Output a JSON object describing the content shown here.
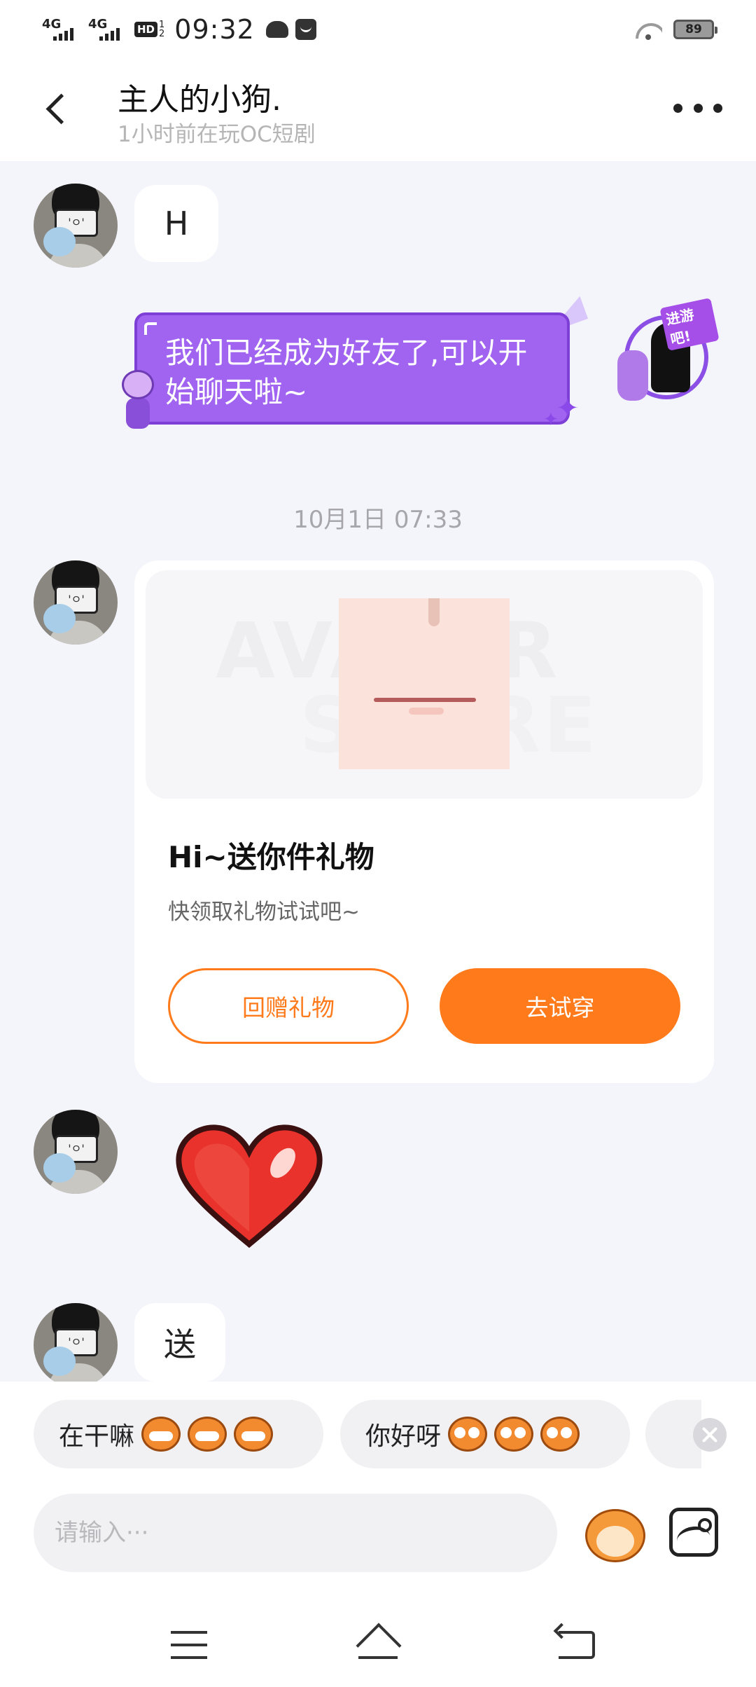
{
  "status_bar": {
    "network1": "4G",
    "network2": "4G",
    "hd_label": "HD",
    "hd_sub1": "1",
    "hd_sub2": "2",
    "time": "09:32",
    "battery": "89"
  },
  "header": {
    "title": "主人的小狗.",
    "subtitle": "1小时前在玩OC短剧"
  },
  "messages": {
    "first": "H",
    "system_bubble": "我们已经成为好友了,可以开始聊天啦~",
    "sticker_tag": "进游吧!",
    "timestamp": "10月1日 07:33",
    "last": "送"
  },
  "gift_card": {
    "watermark1": "AVATAR",
    "watermark2": "STORE",
    "title": "Hi~送你件礼物",
    "description": "快领取礼物试试吧~",
    "return_button": "回赠礼物",
    "try_button": "去试穿"
  },
  "quick_replies": [
    {
      "text": "在干嘛"
    },
    {
      "text": "你好呀"
    }
  ],
  "input": {
    "placeholder": "请输入···"
  },
  "colors": {
    "accent": "#ff7a1a",
    "purple_bubble": "#a064f0",
    "background": "#f4f5fa"
  }
}
